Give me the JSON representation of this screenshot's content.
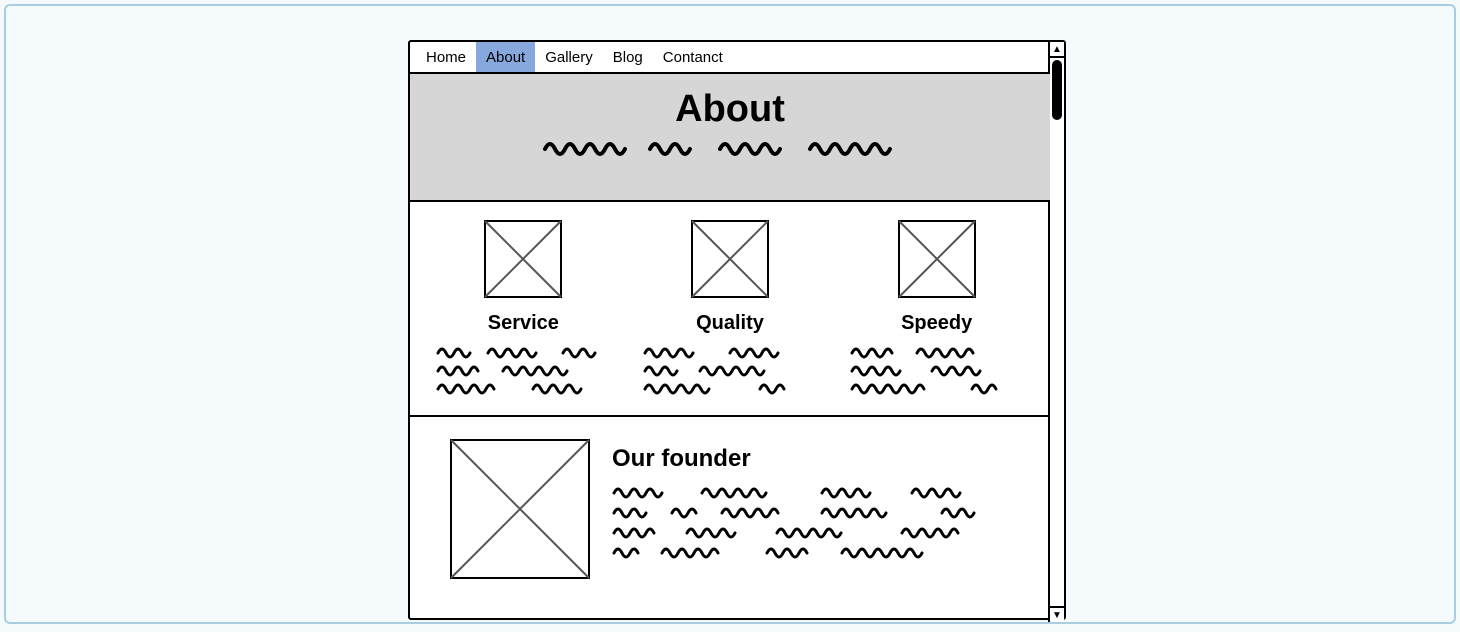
{
  "nav": {
    "items": [
      {
        "label": "Home",
        "active": false
      },
      {
        "label": "About",
        "active": true
      },
      {
        "label": "Gallery",
        "active": false
      },
      {
        "label": "Blog",
        "active": false
      },
      {
        "label": "Contanct",
        "active": false
      }
    ]
  },
  "hero": {
    "title": "About"
  },
  "features": [
    {
      "title": "Service"
    },
    {
      "title": "Quality"
    },
    {
      "title": "Speedy"
    }
  ],
  "founder": {
    "title": "Our founder"
  },
  "colors": {
    "page_bg": "#f5fafd",
    "page_border": "#a9cde1",
    "nav_active": "#86a8dc",
    "hero_bg": "#d6d6d6"
  }
}
